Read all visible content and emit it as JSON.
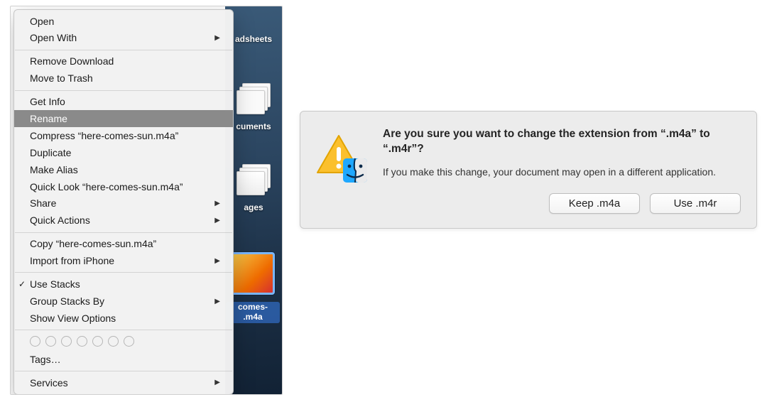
{
  "context_menu": {
    "groups": [
      [
        {
          "label": "Open",
          "submenu": false
        },
        {
          "label": "Open With",
          "submenu": true
        }
      ],
      [
        {
          "label": "Remove Download",
          "submenu": false
        },
        {
          "label": "Move to Trash",
          "submenu": false
        }
      ],
      [
        {
          "label": "Get Info",
          "submenu": false
        },
        {
          "label": "Rename",
          "submenu": false,
          "highlighted": true
        },
        {
          "label": "Compress “here-comes-sun.m4a”",
          "submenu": false
        },
        {
          "label": "Duplicate",
          "submenu": false
        },
        {
          "label": "Make Alias",
          "submenu": false
        },
        {
          "label": "Quick Look “here-comes-sun.m4a”",
          "submenu": false
        },
        {
          "label": "Share",
          "submenu": true
        },
        {
          "label": "Quick Actions",
          "submenu": true
        }
      ],
      [
        {
          "label": "Copy “here-comes-sun.m4a”",
          "submenu": false
        },
        {
          "label": "Import from iPhone",
          "submenu": true
        }
      ],
      [
        {
          "label": "Use Stacks",
          "submenu": false,
          "checked": true
        },
        {
          "label": "Group Stacks By",
          "submenu": true
        },
        {
          "label": "Show View Options",
          "submenu": false
        }
      ]
    ],
    "tags_label": "Tags…",
    "services_label": "Services",
    "tag_count": 7
  },
  "desktop": {
    "labels": {
      "spreadsheets": "adsheets",
      "documents": "cuments",
      "images": "ages",
      "file_caption": "comes-\n.m4a"
    }
  },
  "dialog": {
    "title": "Are you sure you want to change the extension from “.m4a” to “.m4r”?",
    "body": "If you make this change, your document may open in a different application.",
    "keep_btn": "Keep .m4a",
    "use_btn": "Use .m4r"
  }
}
